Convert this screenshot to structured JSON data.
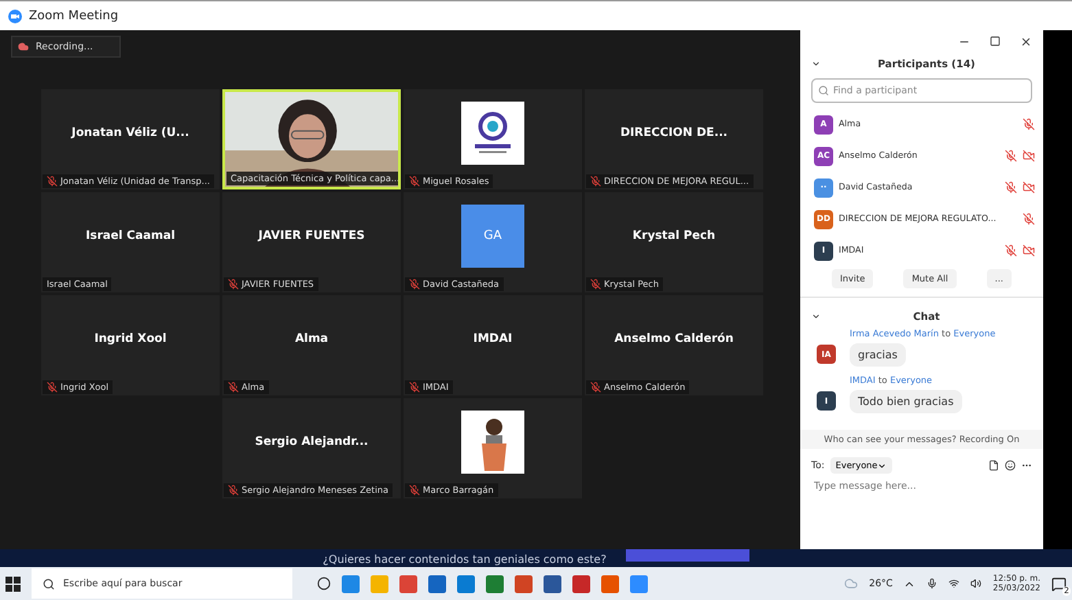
{
  "window": {
    "title": "Zoom Meeting"
  },
  "recording": {
    "label": "Recording..."
  },
  "tiles": [
    {
      "kind": "name",
      "title": "Jonatan Véliz (U...",
      "name": "Jonatan Véliz (Unidad de Transp...",
      "muted": true,
      "speaking": false
    },
    {
      "kind": "video",
      "name": "Capacitación Técnica y Política capa...",
      "muted": false,
      "speaking": true
    },
    {
      "kind": "logo",
      "name": "Miguel Rosales",
      "muted": true,
      "speaking": false
    },
    {
      "kind": "name",
      "title": "DIRECCION  DE...",
      "name": "DIRECCION DE MEJORA REGUL...",
      "muted": true,
      "speaking": false
    },
    {
      "kind": "name",
      "title": "Israel Caamal",
      "name": "Israel Caamal",
      "muted": false,
      "speaking": false
    },
    {
      "kind": "name",
      "title": "JAVIER FUENTES",
      "name": "JAVIER FUENTES",
      "muted": true,
      "speaking": false
    },
    {
      "kind": "initials",
      "title": "GA",
      "name": "David Castañeda",
      "muted": true,
      "speaking": false
    },
    {
      "kind": "name",
      "title": "Krystal Pech",
      "name": "Krystal Pech",
      "muted": true,
      "speaking": false
    },
    {
      "kind": "name",
      "title": "Ingrid Xool",
      "name": "Ingrid Xool",
      "muted": true,
      "speaking": false
    },
    {
      "kind": "name",
      "title": "Alma",
      "name": "Alma",
      "muted": true,
      "speaking": false
    },
    {
      "kind": "name",
      "title": "IMDAI",
      "name": "IMDAI",
      "muted": true,
      "speaking": false
    },
    {
      "kind": "name",
      "title": "Anselmo Calderón",
      "name": "Anselmo Calderón",
      "muted": true,
      "speaking": false
    },
    {
      "kind": "empty"
    },
    {
      "kind": "name",
      "title": "Sergio  Alejandr...",
      "name": "Sergio Alejandro Meneses Zetina",
      "muted": true,
      "speaking": false
    },
    {
      "kind": "avatar",
      "name": "Marco Barragán",
      "muted": true,
      "speaking": false
    }
  ],
  "participants": {
    "title": "Participants (14)",
    "search": {
      "placeholder": "Find a participant"
    },
    "items": [
      {
        "initials": "A",
        "color": "#8e3fb5",
        "name": "Alma",
        "muted": true,
        "video_off": false
      },
      {
        "initials": "AC",
        "color": "#8e3fb5",
        "name": "Anselmo Calderón",
        "muted": true,
        "video_off": true
      },
      {
        "initials": "··",
        "color": "#4a90e2",
        "name": "David Castañeda",
        "muted": true,
        "video_off": true
      },
      {
        "initials": "DD",
        "color": "#d9621c",
        "name": "DIRECCION DE MEJORA REGULATO...",
        "muted": true,
        "video_off": false
      },
      {
        "initials": "I",
        "color": "#2c3e50",
        "name": "IMDAI",
        "muted": true,
        "video_off": true
      }
    ],
    "buttons": [
      "Invite",
      "Mute All",
      "..."
    ]
  },
  "chat": {
    "title": "Chat",
    "messages": [
      {
        "initials": "IA",
        "color": "#c0392b",
        "sender": "Irma Acevedo Marín",
        "to_word": "to",
        "recipient": "Everyone",
        "text": "gracias"
      },
      {
        "initials": "I",
        "color": "#2c3e50",
        "sender": "IMDAI",
        "to_word": "to",
        "recipient": "Everyone",
        "text": "Todo bien gracias"
      }
    ],
    "notice": "Who can see your messages? Recording On",
    "to_label": "To:",
    "to_value": "Everyone",
    "placeholder": "Type message here..."
  },
  "banner": {
    "text": "¿Quieres hacer contenidos tan geniales como este?"
  },
  "taskbar": {
    "search": {
      "placeholder": "Escribe aquí para buscar"
    },
    "temperature": "26°C",
    "time": "12:50 p. m.",
    "date": "25/03/2022",
    "notifications": "2"
  }
}
